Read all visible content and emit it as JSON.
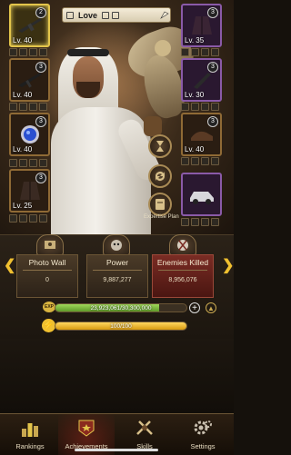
{
  "profile": {
    "name": "Love",
    "flag_icon": "falcon-flag-icon"
  },
  "equipment": {
    "left": [
      {
        "level": "Lv. 40",
        "badge": "2",
        "item_icon": "rifle-icon",
        "rarity": "gold"
      },
      {
        "level": "Lv. 40",
        "badge": "3",
        "item_icon": "rifle-icon",
        "rarity": "normal"
      },
      {
        "level": "Lv. 40",
        "badge": "3",
        "item_icon": "sapphire-ring-icon",
        "rarity": "normal"
      },
      {
        "level": "Lv. 25",
        "badge": "3",
        "item_icon": "coat-icon",
        "rarity": "normal"
      }
    ],
    "right": [
      {
        "level": "Lv. 35",
        "badge": "3",
        "item_icon": "coat-icon",
        "rarity": "purple"
      },
      {
        "level": "Lv. 30",
        "badge": "3",
        "item_icon": "knife-icon",
        "rarity": "purple"
      },
      {
        "level": "Lv. 40",
        "badge": "3",
        "item_icon": "shoe-icon",
        "rarity": "normal"
      },
      {
        "level": "",
        "badge": "",
        "item_icon": "car-icon",
        "rarity": "purple"
      }
    ]
  },
  "side_buttons": {
    "hourglass_icon": "hourglass-icon",
    "refresh_icon": "refresh-icon",
    "expertise_label": "Expertise Plan"
  },
  "stats": [
    {
      "title": "Photo Wall",
      "value": "0",
      "icon": "photo-wall-icon"
    },
    {
      "title": "Power",
      "value": "9,887,277",
      "icon": "power-icon"
    },
    {
      "title": "Enemies Killed",
      "value": "8,956,076",
      "icon": "enemies-killed-icon"
    }
  ],
  "exp": {
    "label": "EXP",
    "text": "23,923,061/30,300,000",
    "fraction": 0.79
  },
  "energy": {
    "text": "100/100",
    "fraction": 1.0
  },
  "nav": {
    "items": [
      {
        "label": "Rankings",
        "icon": "rankings-icon"
      },
      {
        "label": "Achievements",
        "icon": "achievements-icon"
      },
      {
        "label": "Skills",
        "icon": "skills-icon"
      },
      {
        "label": "Settings",
        "icon": "settings-gear-icon"
      }
    ],
    "active_index": 1
  },
  "colors": {
    "gold": "#e3c54b",
    "purple": "#8a5aa8",
    "exp_green": "#7fbf3f",
    "energy_yellow": "#f0c030",
    "enemies_red": "#7a2c24"
  }
}
